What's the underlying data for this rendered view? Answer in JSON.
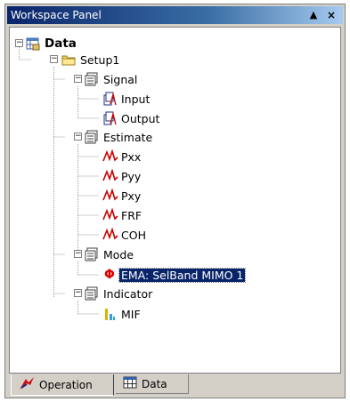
{
  "window": {
    "title": "Workspace Panel",
    "pin_glyph": "▲",
    "close_glyph": "×"
  },
  "tree": {
    "root": {
      "label": "Data",
      "icon": "data-table-icon"
    },
    "setup": {
      "label": "Setup1",
      "icon": "folder-icon"
    },
    "signal": {
      "label": "Signal",
      "icon": "group-icon",
      "children": [
        {
          "label": "Input",
          "icon": "signal-file-icon"
        },
        {
          "label": "Output",
          "icon": "signal-file-icon"
        }
      ]
    },
    "estimate": {
      "label": "Estimate",
      "icon": "group-icon",
      "children": [
        {
          "label": "Pxx",
          "icon": "spectrum-icon"
        },
        {
          "label": "Pyy",
          "icon": "spectrum-icon"
        },
        {
          "label": "Pxy",
          "icon": "spectrum-icon"
        },
        {
          "label": "FRF",
          "icon": "spectrum-icon"
        },
        {
          "label": "COH",
          "icon": "spectrum-icon"
        }
      ]
    },
    "mode": {
      "label": "Mode",
      "icon": "group-icon",
      "children": [
        {
          "label": "EMA: SelBand MIMO 1",
          "icon": "phi-icon",
          "glyph": "Φ",
          "selected": true
        }
      ]
    },
    "indicator": {
      "label": "Indicator",
      "icon": "group-icon",
      "children": [
        {
          "label": "MIF",
          "icon": "bar-chart-icon"
        }
      ]
    }
  },
  "tabs": [
    {
      "label": "Operation",
      "icon": "operation-icon",
      "active": true
    },
    {
      "label": "Data",
      "icon": "data-grid-icon",
      "active": false
    }
  ],
  "colors": {
    "title_start": "#0a246a",
    "title_end": "#a6caf0",
    "selection": "#0a246a",
    "spectrum": "#cc0000",
    "phi": "#dd0000"
  }
}
